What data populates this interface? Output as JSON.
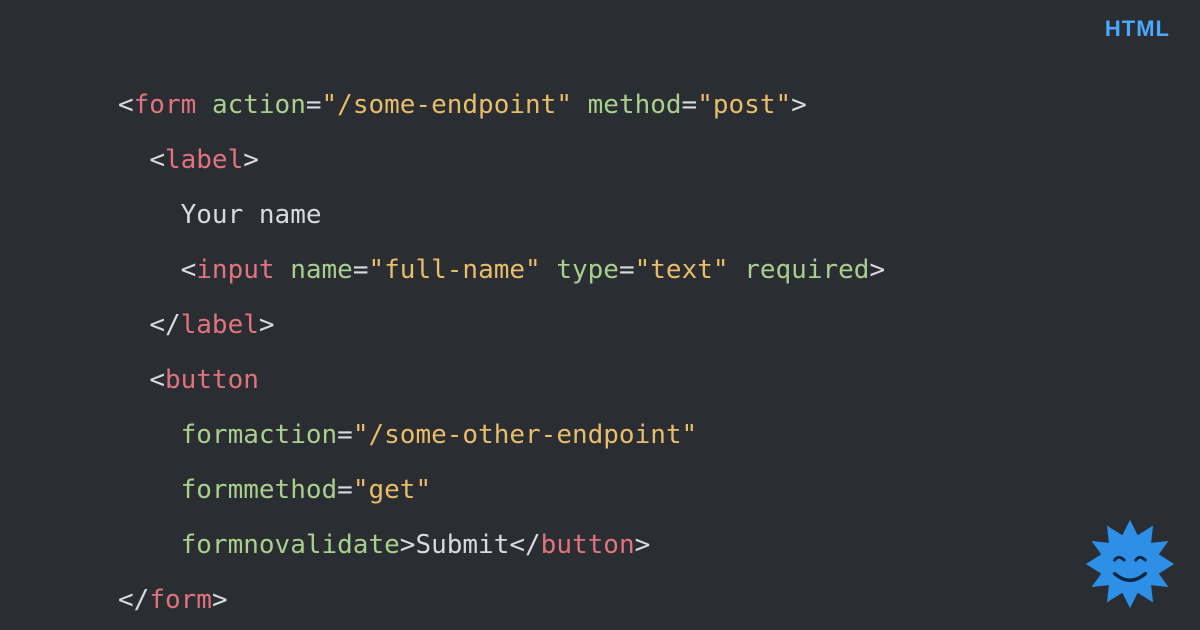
{
  "language_badge": "HTML",
  "code": {
    "lines": [
      {
        "indent": 0,
        "tokens": [
          {
            "t": "punct",
            "v": "<"
          },
          {
            "t": "tag",
            "v": "form"
          },
          {
            "t": "punct",
            "v": " "
          },
          {
            "t": "attr",
            "v": "action"
          },
          {
            "t": "eq",
            "v": "="
          },
          {
            "t": "str",
            "v": "\"/some-endpoint\""
          },
          {
            "t": "punct",
            "v": " "
          },
          {
            "t": "attr",
            "v": "method"
          },
          {
            "t": "eq",
            "v": "="
          },
          {
            "t": "str",
            "v": "\"post\""
          },
          {
            "t": "punct",
            "v": ">"
          }
        ]
      },
      {
        "indent": 1,
        "tokens": [
          {
            "t": "punct",
            "v": "<"
          },
          {
            "t": "tag",
            "v": "label"
          },
          {
            "t": "punct",
            "v": ">"
          }
        ]
      },
      {
        "indent": 2,
        "tokens": [
          {
            "t": "text",
            "v": "Your name"
          }
        ]
      },
      {
        "indent": 2,
        "tokens": [
          {
            "t": "punct",
            "v": "<"
          },
          {
            "t": "tag",
            "v": "input"
          },
          {
            "t": "punct",
            "v": " "
          },
          {
            "t": "attr",
            "v": "name"
          },
          {
            "t": "eq",
            "v": "="
          },
          {
            "t": "str",
            "v": "\"full-name\""
          },
          {
            "t": "punct",
            "v": " "
          },
          {
            "t": "attr",
            "v": "type"
          },
          {
            "t": "eq",
            "v": "="
          },
          {
            "t": "str",
            "v": "\"text\""
          },
          {
            "t": "punct",
            "v": " "
          },
          {
            "t": "attr",
            "v": "required"
          },
          {
            "t": "punct",
            "v": ">"
          }
        ]
      },
      {
        "indent": 1,
        "tokens": [
          {
            "t": "punct",
            "v": "</"
          },
          {
            "t": "tag",
            "v": "label"
          },
          {
            "t": "punct",
            "v": ">"
          }
        ]
      },
      {
        "indent": 1,
        "tokens": [
          {
            "t": "punct",
            "v": "<"
          },
          {
            "t": "tag",
            "v": "button"
          }
        ]
      },
      {
        "indent": 2,
        "tokens": [
          {
            "t": "attr",
            "v": "formaction"
          },
          {
            "t": "eq",
            "v": "="
          },
          {
            "t": "str",
            "v": "\"/some-other-endpoint\""
          }
        ]
      },
      {
        "indent": 2,
        "tokens": [
          {
            "t": "attr",
            "v": "formmethod"
          },
          {
            "t": "eq",
            "v": "="
          },
          {
            "t": "str",
            "v": "\"get\""
          }
        ]
      },
      {
        "indent": 2,
        "tokens": [
          {
            "t": "attr",
            "v": "formnovalidate"
          },
          {
            "t": "punct",
            "v": ">"
          },
          {
            "t": "text",
            "v": "Submit"
          },
          {
            "t": "punct",
            "v": "</"
          },
          {
            "t": "tag",
            "v": "button"
          },
          {
            "t": "punct",
            "v": ">"
          }
        ]
      },
      {
        "indent": 0,
        "tokens": [
          {
            "t": "punct",
            "v": "</"
          },
          {
            "t": "tag",
            "v": "form"
          },
          {
            "t": "punct",
            "v": ">"
          }
        ]
      }
    ],
    "indent_unit": "  "
  }
}
